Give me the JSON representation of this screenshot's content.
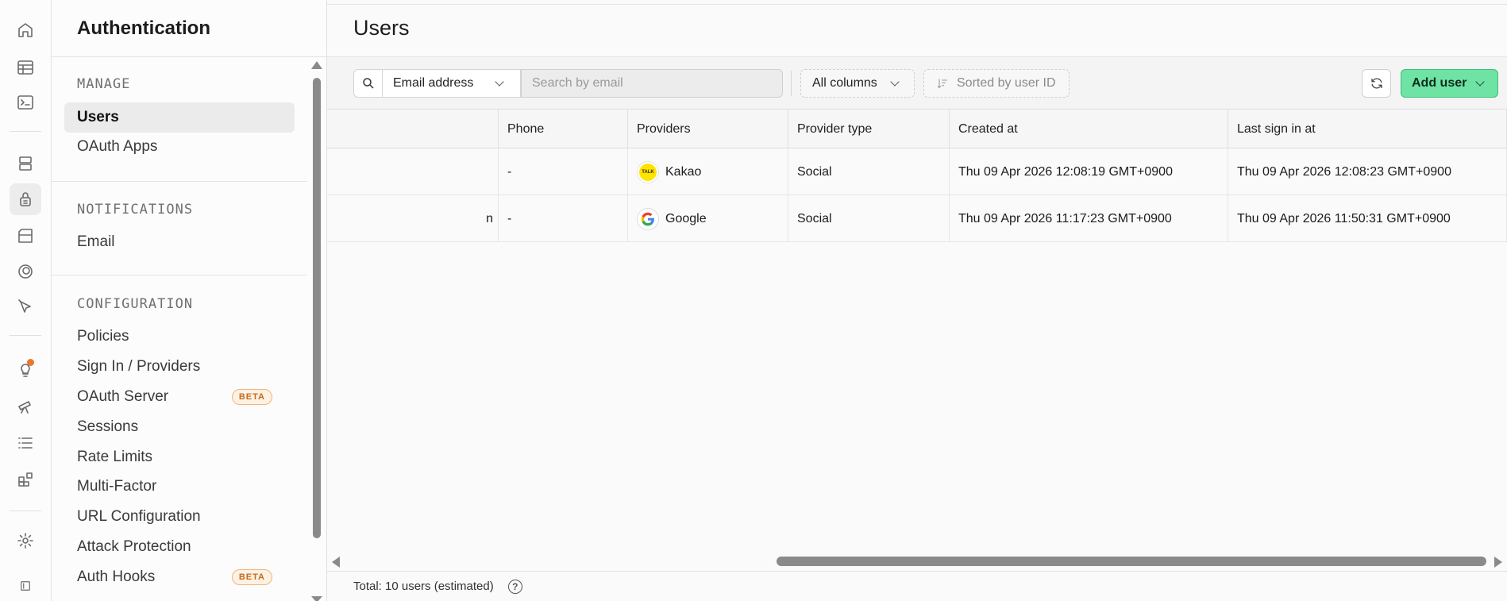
{
  "sidebar": {
    "title": "Authentication",
    "sections": {
      "manage": {
        "title": "MANAGE",
        "items": [
          "Users",
          "OAuth Apps"
        ]
      },
      "notifications": {
        "title": "NOTIFICATIONS",
        "items": [
          "Email"
        ]
      },
      "configuration": {
        "title": "CONFIGURATION",
        "items": [
          "Policies",
          "Sign In / Providers",
          "OAuth Server",
          "Sessions",
          "Rate Limits",
          "Multi-Factor",
          "URL Configuration",
          "Attack Protection",
          "Auth Hooks"
        ]
      }
    },
    "beta_label": "BETA"
  },
  "main": {
    "title": "Users",
    "toolbar": {
      "field_select": "Email address",
      "search_placeholder": "Search by email",
      "columns_button": "All columns",
      "sort_button": "Sorted by user ID",
      "add_user_button": "Add user"
    },
    "table": {
      "columns": [
        "",
        "Phone",
        "Providers",
        "Provider type",
        "Created at",
        "Last sign in at"
      ],
      "rows": [
        {
          "first": "",
          "phone": "-",
          "provider": "Kakao",
          "provider_icon": "kakao-icon",
          "provider_icon_text": "TALK",
          "provider_type": "Social",
          "created_at": "Thu 09 Apr 2026 12:08:19 GMT+0900",
          "last_sign_in": "Thu 09 Apr 2026 12:08:23 GMT+0900"
        },
        {
          "first": "n",
          "phone": "-",
          "provider": "Google",
          "provider_icon": "google-icon",
          "provider_icon_text": "G",
          "provider_type": "Social",
          "created_at": "Thu 09 Apr 2026 11:17:23 GMT+0900",
          "last_sign_in": "Thu 09 Apr 2026 11:50:31 GMT+0900"
        }
      ]
    },
    "footer": {
      "total": "Total: 10 users (estimated)",
      "help": "?"
    }
  },
  "colors": {
    "accent": "#6ee3a4",
    "notification_dot": "#e8792c",
    "kakao": "#fee500"
  }
}
